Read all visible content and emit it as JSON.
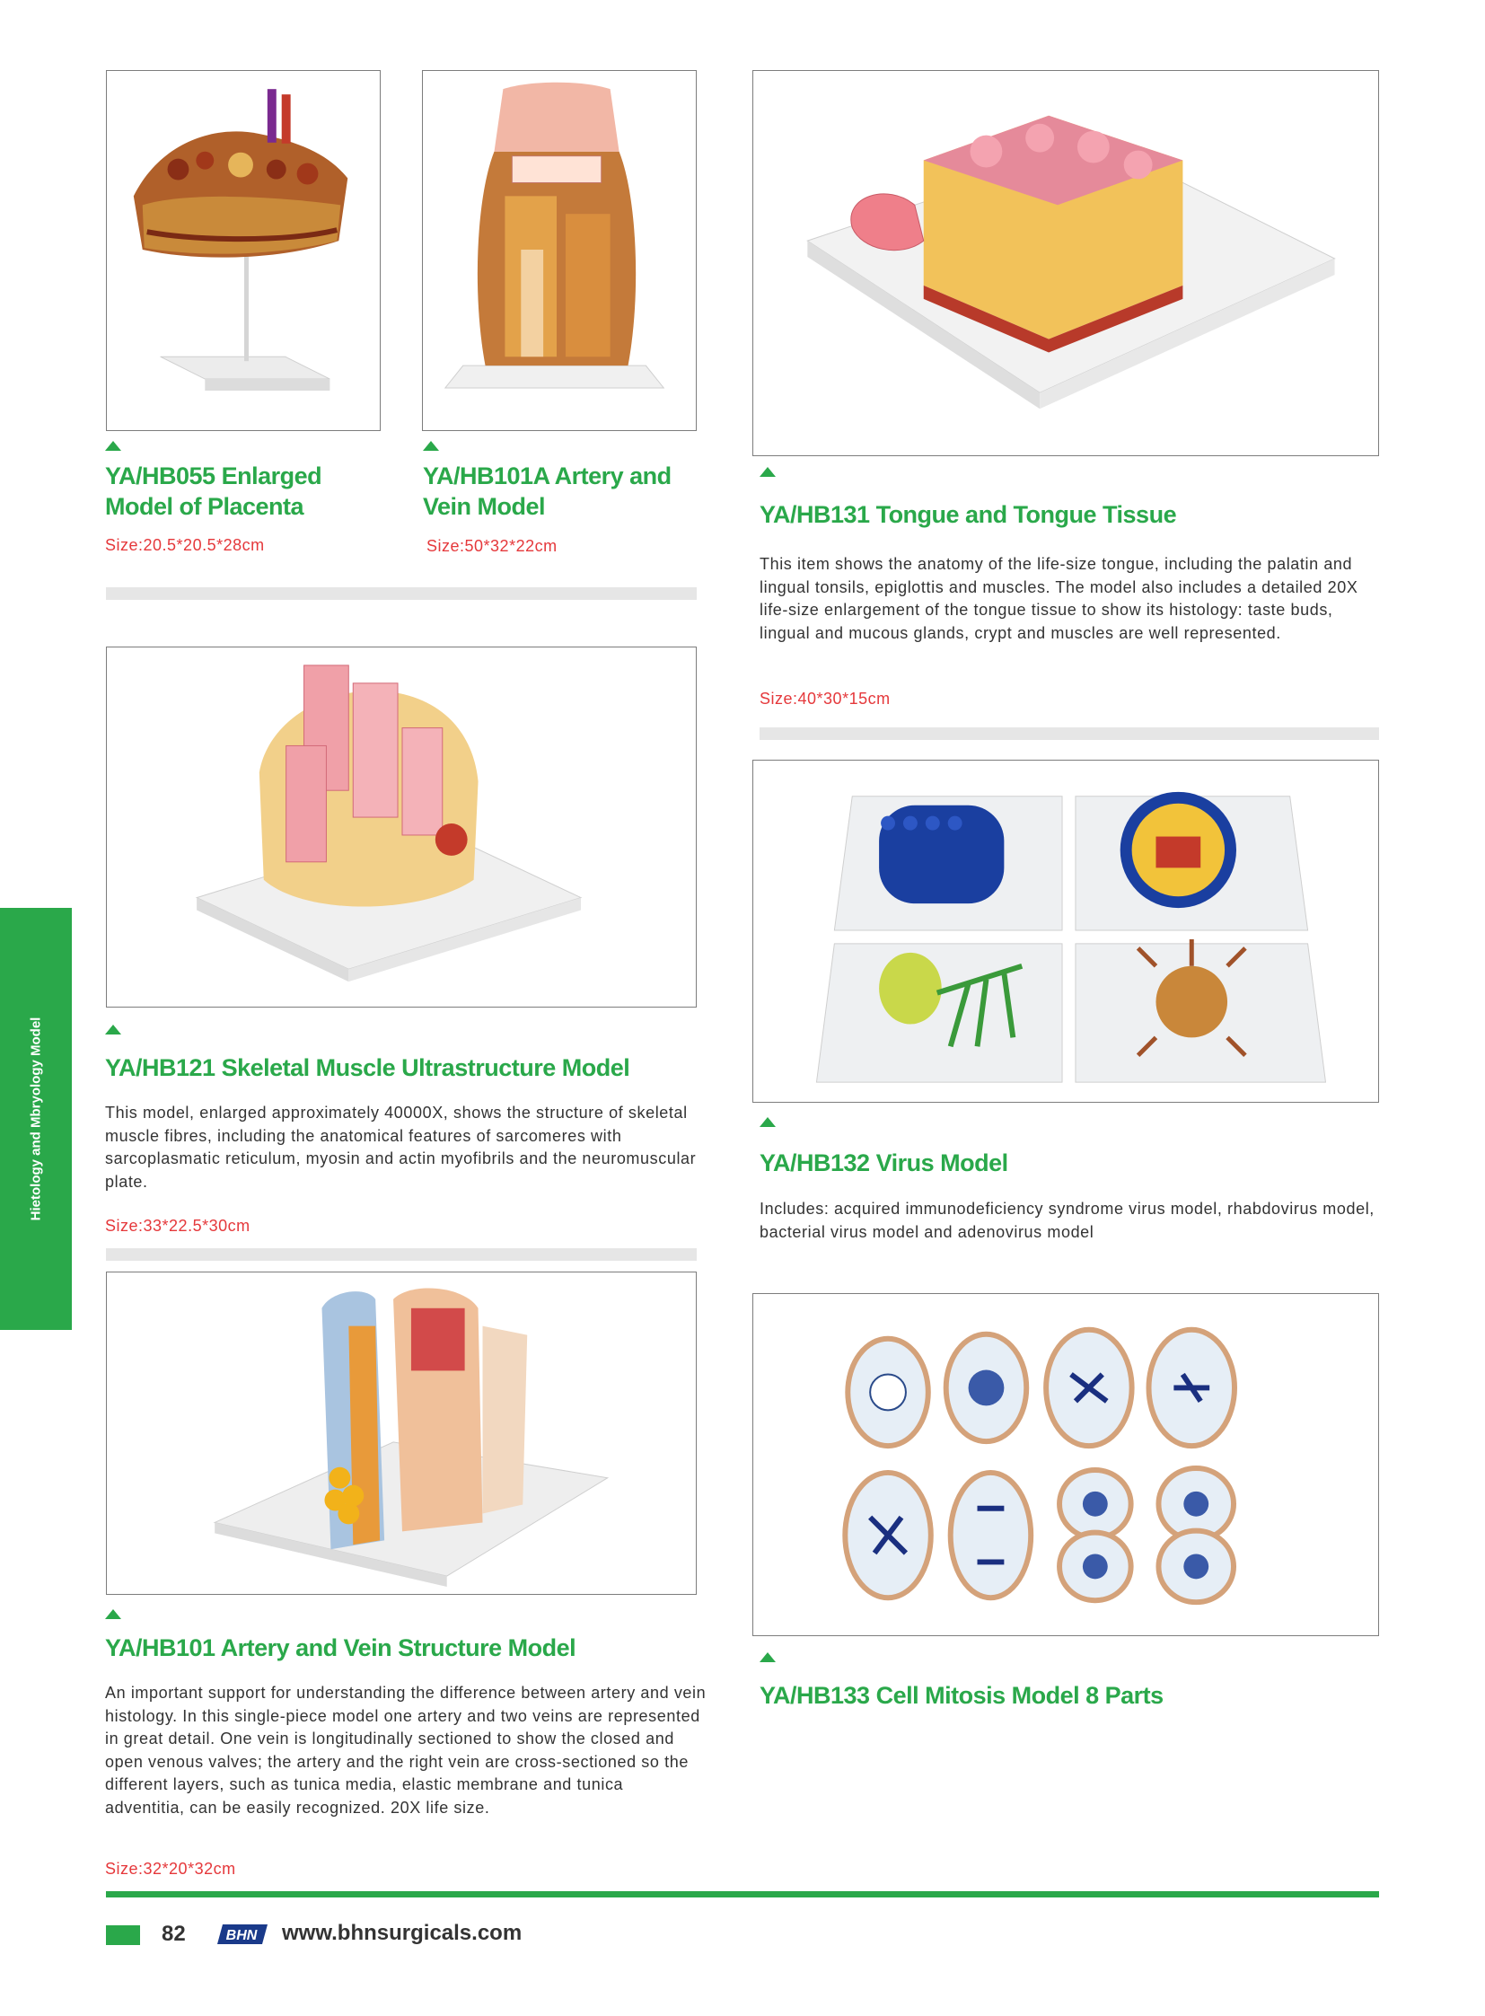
{
  "side_tab": {
    "label": "Hietology and Mbryology Model"
  },
  "products": {
    "p055": {
      "title": "YA/HB055 Enlarged Model of Placenta",
      "size": "Size:20.5*20.5*28cm"
    },
    "p101a": {
      "title": "YA/HB101A Artery and Vein Model",
      "size": "Size:50*32*22cm"
    },
    "p131": {
      "title": "YA/HB131 Tongue and Tongue Tissue",
      "description": "This item shows the anatomy of the life-size tongue, including the palatin and lingual tonsils, epiglottis and muscles. The model also includes a detailed 20X life-size enlargement of the tongue tissue to show its histology: taste buds, lingual and mucous glands, crypt and muscles are well represented.",
      "size": "Size:40*30*15cm"
    },
    "p121": {
      "title": "YA/HB121 Skeletal Muscle Ultrastructure Model",
      "description": "This model, enlarged approximately 40000X, shows the structure of skeletal muscle fibres, including the anatomical features of sarcomeres with sarcoplasmatic reticulum, myosin and actin myofibrils and the neuromuscular plate.",
      "size": "Size:33*22.5*30cm"
    },
    "p132": {
      "title": "YA/HB132 Virus Model",
      "description": "Includes: acquired immunodeficiency syndrome virus model, rhabdovirus  model, bacterial virus model and adenovirus model"
    },
    "p101": {
      "title": "YA/HB101 Artery and Vein Structure Model",
      "description": "An important support for understanding the difference between artery and vein histology. In this single-piece model one artery and two veins are represented in great detail. One vein is longitudinally sectioned to show the closed and open venous valves; the artery and the right vein are cross-sectioned so the different layers, such as tunica media, elastic membrane and tunica adventitia, can be easily recognized. 20X life size.",
      "size": "Size:32*20*32cm"
    },
    "p133": {
      "title": "YA/HB133 Cell Mitosis Model 8 Parts"
    }
  },
  "footer": {
    "page_number": "82",
    "logo_text": "BHN",
    "website": "www.bhnsurgicals.com"
  },
  "colors": {
    "accent_green": "#2aa84a",
    "size_red": "#e5383b",
    "text": "#333333",
    "divider": "#e6e6e6"
  }
}
